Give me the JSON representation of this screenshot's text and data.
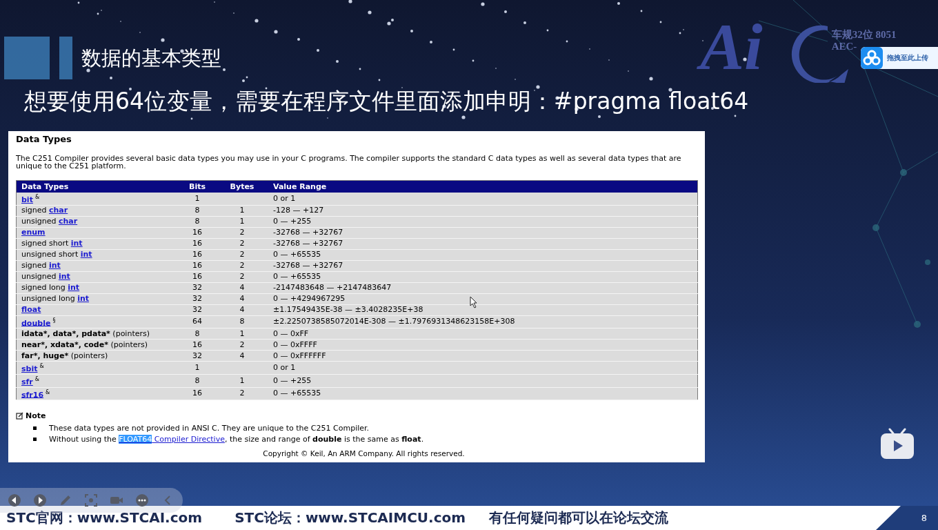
{
  "slide": {
    "title": "数据的基本类型",
    "headline": "想要使用64位变量，需要在程序文件里面添加申明：#pragma float64",
    "logo_text": "Ai",
    "logo_caption": [
      "车规32位 8051",
      "AEC-"
    ],
    "page_number": "8"
  },
  "upload_widget": {
    "label": "拖拽至此上传"
  },
  "document": {
    "title": "Data Types",
    "intro": "The C251 Compiler provides several basic data types you may use in your C programs. The compiler supports the standard C data types as well as several data types that are unique to the C251 platform.",
    "table": {
      "columns": [
        "Data Types",
        "Bits",
        "Bytes",
        "Value Range"
      ],
      "rows": [
        {
          "type": [
            {
              "kind": "link",
              "text": "bit"
            },
            {
              "kind": "mark",
              "text": "&"
            }
          ],
          "bits": "1",
          "value_range": "0 or 1"
        },
        {
          "type": [
            {
              "kind": "plain",
              "text": "signed "
            },
            {
              "kind": "link",
              "text": "char"
            }
          ],
          "bits": "8",
          "bytes": "1",
          "value_range": "-128 — +127"
        },
        {
          "type": [
            {
              "kind": "plain",
              "text": "unsigned "
            },
            {
              "kind": "link",
              "text": "char"
            }
          ],
          "bits": "8",
          "bytes": "1",
          "value_range": "0 — +255"
        },
        {
          "type": [
            {
              "kind": "link",
              "text": "enum"
            }
          ],
          "bits": "16",
          "bytes": "2",
          "value_range": "-32768 — +32767"
        },
        {
          "type": [
            {
              "kind": "plain",
              "text": "signed short "
            },
            {
              "kind": "link",
              "text": "int"
            }
          ],
          "bits": "16",
          "bytes": "2",
          "value_range": "-32768 — +32767"
        },
        {
          "type": [
            {
              "kind": "plain",
              "text": "unsigned short "
            },
            {
              "kind": "link",
              "text": "int"
            }
          ],
          "bits": "16",
          "bytes": "2",
          "value_range": "0 — +65535"
        },
        {
          "type": [
            {
              "kind": "plain",
              "text": "signed "
            },
            {
              "kind": "link",
              "text": "int"
            }
          ],
          "bits": "16",
          "bytes": "2",
          "value_range": "-32768 — +32767"
        },
        {
          "type": [
            {
              "kind": "plain",
              "text": "unsigned "
            },
            {
              "kind": "link",
              "text": "int"
            }
          ],
          "bits": "16",
          "bytes": "2",
          "value_range": "0 — +65535"
        },
        {
          "type": [
            {
              "kind": "plain",
              "text": "signed long "
            },
            {
              "kind": "link",
              "text": "int"
            }
          ],
          "bits": "32",
          "bytes": "4",
          "value_range": "-2147483648 — +2147483647"
        },
        {
          "type": [
            {
              "kind": "plain",
              "text": "unsigned long "
            },
            {
              "kind": "link",
              "text": "int"
            }
          ],
          "bits": "32",
          "bytes": "4",
          "value_range": "0 — +4294967295"
        },
        {
          "type": [
            {
              "kind": "link",
              "text": "float"
            }
          ],
          "bits": "32",
          "bytes": "4",
          "value_range": "±1.17549435E-38 — ±3.4028235E+38"
        },
        {
          "type": [
            {
              "kind": "link",
              "text": "double"
            },
            {
              "kind": "mark",
              "text": "§"
            }
          ],
          "bits": "64",
          "bytes": "8",
          "value_range": "±2.2250738585072014E-308 — ±1.7976931348623158E+308"
        },
        {
          "type": [
            {
              "kind": "bold",
              "text": "idata*, data*, pdata*"
            },
            {
              "kind": "plain",
              "text": " (pointers)"
            }
          ],
          "bits": "8",
          "bytes": "1",
          "value_range": "0 — 0xFF"
        },
        {
          "type": [
            {
              "kind": "bold",
              "text": "near*, xdata*, code*"
            },
            {
              "kind": "plain",
              "text": " (pointers)"
            }
          ],
          "bits": "16",
          "bytes": "2",
          "value_range": "0 — 0xFFFF"
        },
        {
          "type": [
            {
              "kind": "bold",
              "text": "far*, huge*"
            },
            {
              "kind": "plain",
              "text": " (pointers)"
            }
          ],
          "bits": "32",
          "bytes": "4",
          "value_range": "0 — 0xFFFFFF"
        },
        {
          "type": [
            {
              "kind": "link",
              "text": "sbit"
            },
            {
              "kind": "mark",
              "text": "&"
            }
          ],
          "bits": "1",
          "value_range": "0 or 1"
        },
        {
          "type": [
            {
              "kind": "link",
              "text": "sfr"
            },
            {
              "kind": "mark",
              "text": "&"
            }
          ],
          "bits": "8",
          "bytes": "1",
          "value_range": "0 — +255"
        },
        {
          "type": [
            {
              "kind": "link",
              "text": "sfr16"
            },
            {
              "kind": "mark",
              "text": "&"
            }
          ],
          "bits": "16",
          "bytes": "2",
          "value_range": "0 — +65535"
        }
      ]
    },
    "note": {
      "heading": "Note",
      "items": [
        {
          "parts": [
            {
              "kind": "text",
              "text": "These data types are not provided in ANSI C. They are unique to the C251 Compiler."
            }
          ]
        },
        {
          "parts": [
            {
              "kind": "text",
              "text": "Without using the "
            },
            {
              "kind": "link",
              "segments": [
                {
                  "text": "FLOAT64",
                  "selected": true
                },
                {
                  "text": " Compiler Directive",
                  "selected": false
                }
              ]
            },
            {
              "kind": "text",
              "text": ", the size and range of **double** is the same as **float**."
            }
          ]
        }
      ]
    },
    "copyright": "Copyright © Keil, An ARM Company. All rights reserved."
  },
  "footer": {
    "items": [
      "STC官网：www.STCAI.com",
      "STC论坛：www.STCAIMCU.com",
      "有任何疑问都可以在论坛交流"
    ]
  }
}
